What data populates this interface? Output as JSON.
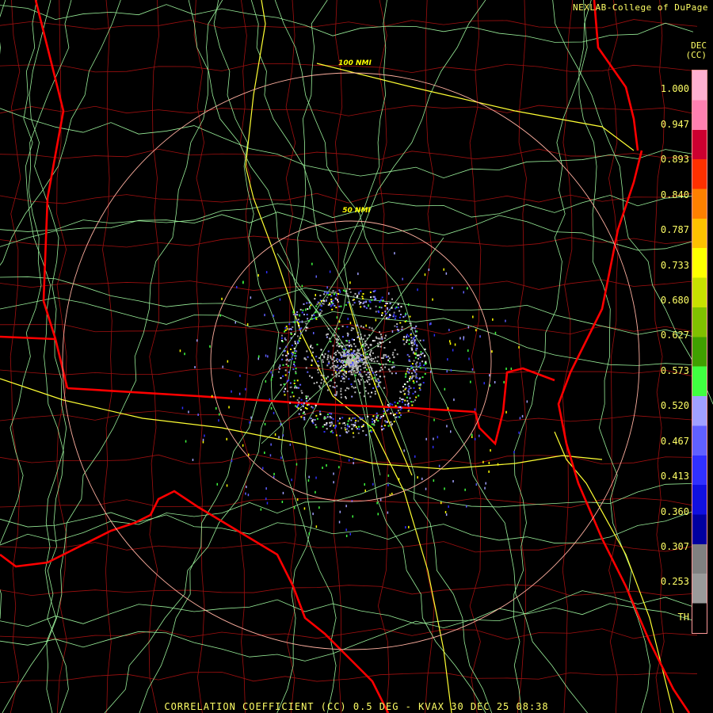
{
  "credit": "NEXLAB-College of DuPage",
  "units": {
    "line1": "DEC",
    "line2": "(CC)"
  },
  "range_rings": [
    {
      "label": "50 NMI"
    },
    {
      "label": "100 NMI"
    }
  ],
  "legend": {
    "labels": [
      "1.000",
      "0.947",
      "0.893",
      "0.840",
      "0.787",
      "0.733",
      "0.680",
      "0.627",
      "0.573",
      "0.520",
      "0.467",
      "0.413",
      "0.360",
      "0.307",
      "0.253",
      "TH"
    ],
    "colors": [
      "#ffb0d0",
      "#ff80b0",
      "#cc0030",
      "#ff3000",
      "#ff8000",
      "#ffc000",
      "#ffff00",
      "#c8e000",
      "#80c000",
      "#40a000",
      "#40ff40",
      "#a0a0ff",
      "#6060ff",
      "#3030ff",
      "#1010e0",
      "#0000a0",
      "#808080",
      "#9a9a9a",
      "#000000"
    ]
  },
  "colors": {
    "state_lines": "#ff0000",
    "county_lines": "#b01010",
    "highways_major": "#ffff33",
    "highways_minor": "#99ee99",
    "range_rings": "#ffb0a0",
    "text": "#ffff66"
  },
  "caption": "CORRELATION COEFFICIENT (CC) 0.5 DEG - KVAX 30 DEC 25 08:38"
}
